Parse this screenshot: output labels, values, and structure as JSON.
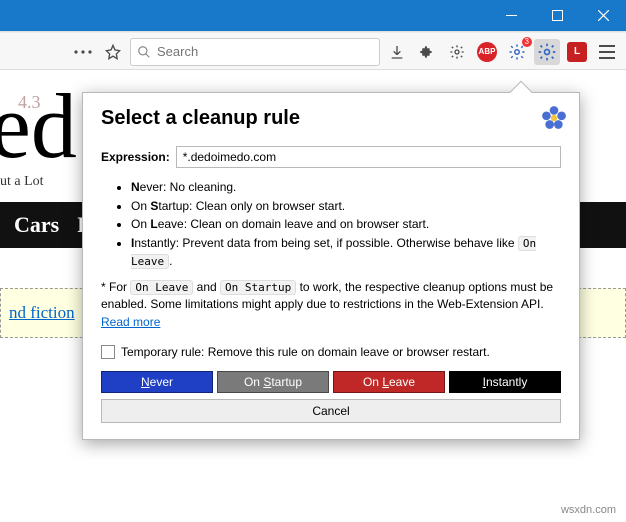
{
  "window": {
    "minimize_label": "Minimize",
    "maximize_label": "Maximize",
    "close_label": "Close"
  },
  "toolbar": {
    "search_placeholder": "Search",
    "abp_label": "ABP",
    "notif_count": "3",
    "lastpass_label": "L"
  },
  "page": {
    "rating1": "4.3",
    "big_fragment": "ed",
    "subtitle": "ut a Lot",
    "nav": {
      "item1": "Cars",
      "item2": "F"
    },
    "link_text": "nd fiction"
  },
  "popup": {
    "title": "Select a cleanup rule",
    "expression_label": "Expression:",
    "expression_value": "*.dedoimedo.com",
    "rules": {
      "never": {
        "key": "N",
        "rest": "ever: No cleaning."
      },
      "startup": {
        "pre": "On ",
        "key": "S",
        "rest": "tartup: Clean only on browser start."
      },
      "leave": {
        "pre": "On ",
        "key": "L",
        "rest": "eave: Clean on domain leave and on browser start."
      },
      "instantly": {
        "key": "I",
        "rest": "nstantly: Prevent data from being set, if possible. Otherwise behave like ",
        "code": "On Leave",
        "tail": "."
      }
    },
    "note_pre": "* For ",
    "note_code1": "On Leave",
    "note_and": " and ",
    "note_code2": "On Startup",
    "note_post": " to work, the respective cleanup options must be enabled. Some limitations might apply due to restrictions in the Web-Extension API. ",
    "note_link": "Read more",
    "temp_label": "Temporary rule: Remove this rule on domain leave or browser restart.",
    "buttons": {
      "never": {
        "u": "N",
        "rest": "ever"
      },
      "startup": {
        "pre": "On ",
        "u": "S",
        "rest": "tartup"
      },
      "leave": {
        "pre": "On ",
        "u": "L",
        "rest": "eave"
      },
      "instantly": {
        "u": "I",
        "rest": "nstantly"
      },
      "cancel": "Cancel"
    }
  },
  "watermark": "wsxdn.com"
}
